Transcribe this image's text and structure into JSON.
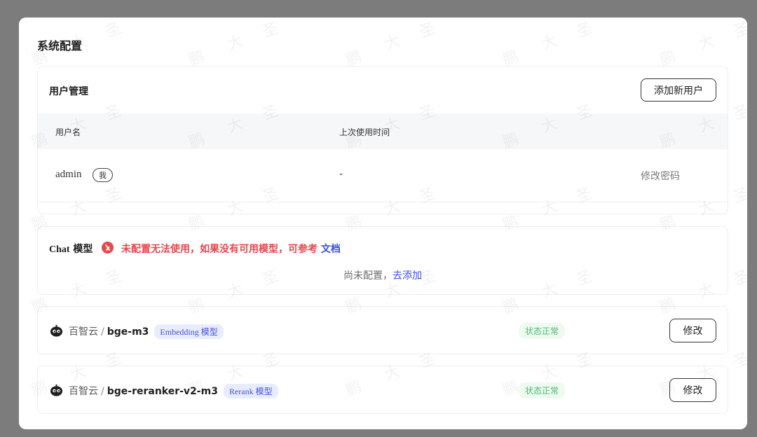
{
  "modal": {
    "title": "系统配置"
  },
  "users": {
    "title": "用户管理",
    "add_button": "添加新用户",
    "columns": [
      "用户名",
      "上次使用时间"
    ],
    "rows": [
      {
        "username": "admin",
        "badge": "我",
        "last_used": "-",
        "action": "修改密码"
      }
    ]
  },
  "chat": {
    "title_en": "Chat",
    "title_cn": " 模型",
    "warn_icon": "warning-icon",
    "warning_text": "未配置无法使用，如果没有可用模型，可参考 ",
    "doc_link": "文档",
    "empty_text": "尚未配置，",
    "add_link": "去添加"
  },
  "models": [
    {
      "provider": "百智云",
      "separator": "/",
      "name": "bge-m3",
      "type": "Embedding 模型",
      "status": "状态正常",
      "edit": "修改"
    },
    {
      "provider": "百智云",
      "separator": "/",
      "name": "bge-reranker-v2-m3",
      "type": "Rerank 模型",
      "status": "状态正常",
      "edit": "修改"
    }
  ],
  "watermark": {
    "chars": [
      "鹏",
      "大",
      "圣"
    ]
  },
  "colors": {
    "accent": "#3a4ee8",
    "danger": "#e5484d",
    "success": "#4fb873",
    "overlay": "#7c7c7c"
  }
}
